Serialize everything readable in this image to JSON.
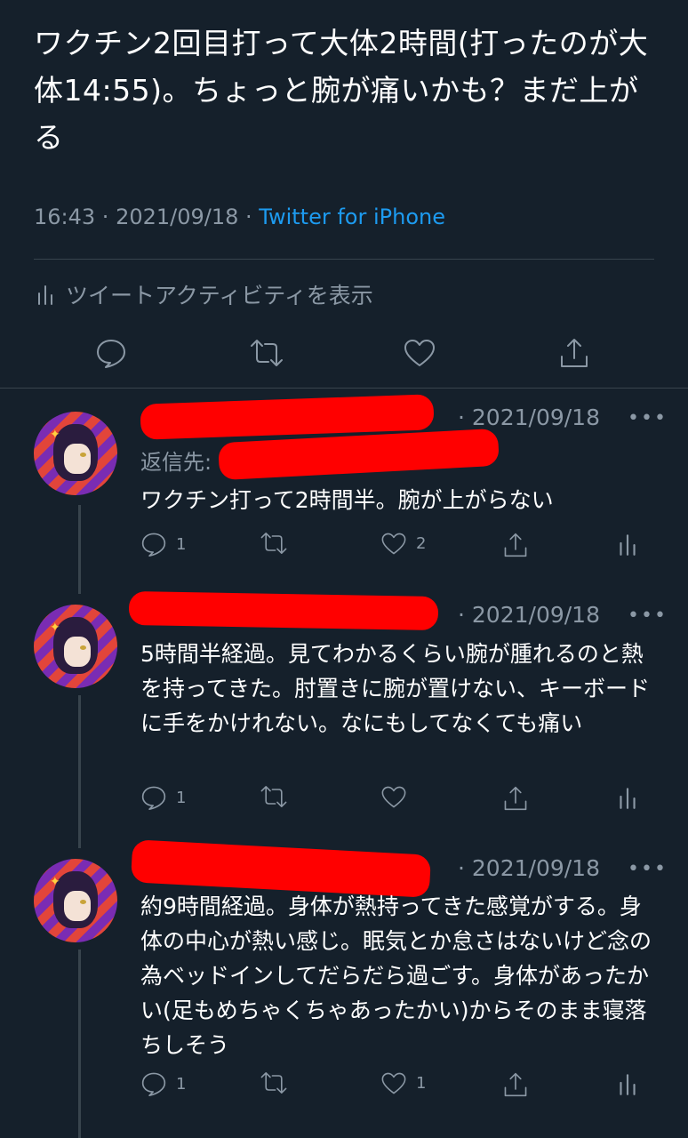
{
  "main_tweet": {
    "text": "ワクチン2回目打って大体2時間(打ったのが大体14:55)。ちょっと腕が痛いかも？まだ上がる",
    "time": "16:43",
    "sep1": " · ",
    "date": "2021/09/18",
    "sep2": " · ",
    "source": "Twitter for iPhone",
    "activity_label": "ツイートアクティビティを表示"
  },
  "replies": [
    {
      "date_line": "· 2021/09/18",
      "more": "•••",
      "reply_to": "返信先:",
      "text": "ワクチン打って2時間半。腕が上がらない",
      "reply_count": "1",
      "retweet_count": "",
      "like_count": "2"
    },
    {
      "date_line": "· 2021/09/18",
      "more": "•••",
      "text": "5時間半経過。見てわかるくらい腕が腫れるのと熱を持ってきた。肘置きに腕が置けない、キーボードに手をかけれない。なにもしてなくても痛い",
      "reply_count": "1",
      "retweet_count": "",
      "like_count": ""
    },
    {
      "date_line": "· 2021/09/18",
      "more": "•••",
      "text": "約9時間経過。身体が熱持ってきた感覚がする。身体の中心が熱い感じ。眠気とか怠さはないけど念の為ベッドインしてだらだら過ごす。身体があったかい(足もめちゃくちゃあったかい)からそのまま寝落ちしそう",
      "reply_count": "1",
      "retweet_count": "",
      "like_count": "1"
    }
  ],
  "colors": {
    "background": "#15202b",
    "link": "#1d9bf0",
    "muted": "#8b98a5",
    "redaction": "#ff0000"
  },
  "icons": [
    "reply-icon",
    "retweet-icon",
    "like-icon",
    "share-icon",
    "analytics-icon",
    "more-icon"
  ]
}
